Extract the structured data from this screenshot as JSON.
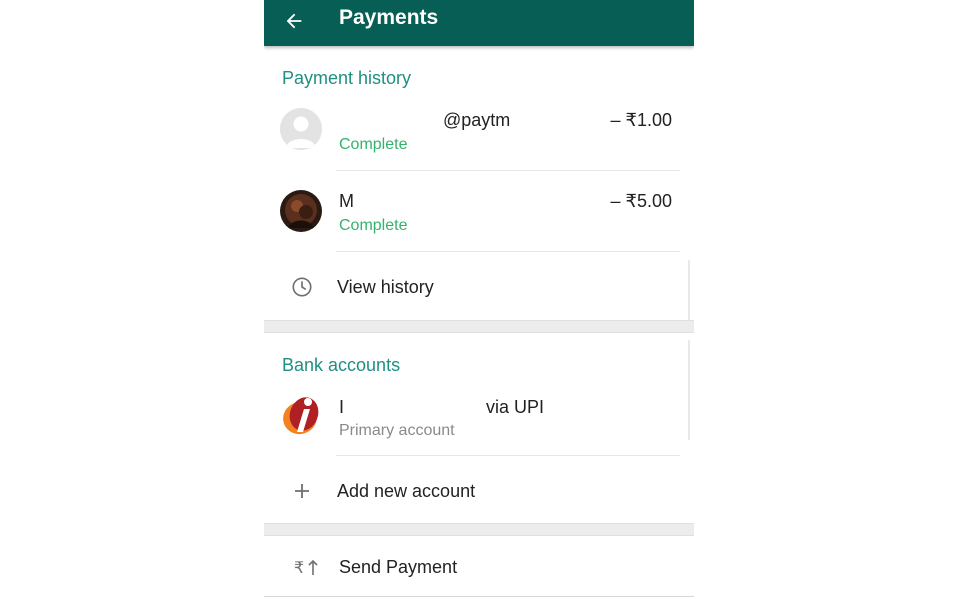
{
  "appbar": {
    "title": "Payments",
    "back_icon": "arrow-left-icon",
    "color": "#075e54"
  },
  "payment_history": {
    "header": "Payment history",
    "items": [
      {
        "name": "@paytm",
        "status": "Complete",
        "amount": "– ₹1.00",
        "avatar": "default-avatar-icon"
      },
      {
        "name": "M",
        "status": "Complete",
        "amount": "– ₹5.00",
        "avatar": "photo-avatar"
      }
    ],
    "view_history_label": "View history",
    "view_history_icon": "clock-icon"
  },
  "bank_accounts": {
    "header": "Bank accounts",
    "items": [
      {
        "name_prefix": "I",
        "name_suffix": "via UPI",
        "subtitle": "Primary account",
        "logo": "icici-logo-icon"
      }
    ],
    "add_label": "Add new account",
    "add_icon": "plus-icon"
  },
  "send_payment": {
    "label": "Send Payment",
    "icon": "rupee-send-icon"
  },
  "colors": {
    "section_header": "#1f8f82",
    "status_complete": "#34b36b",
    "separator": "#ececec"
  }
}
